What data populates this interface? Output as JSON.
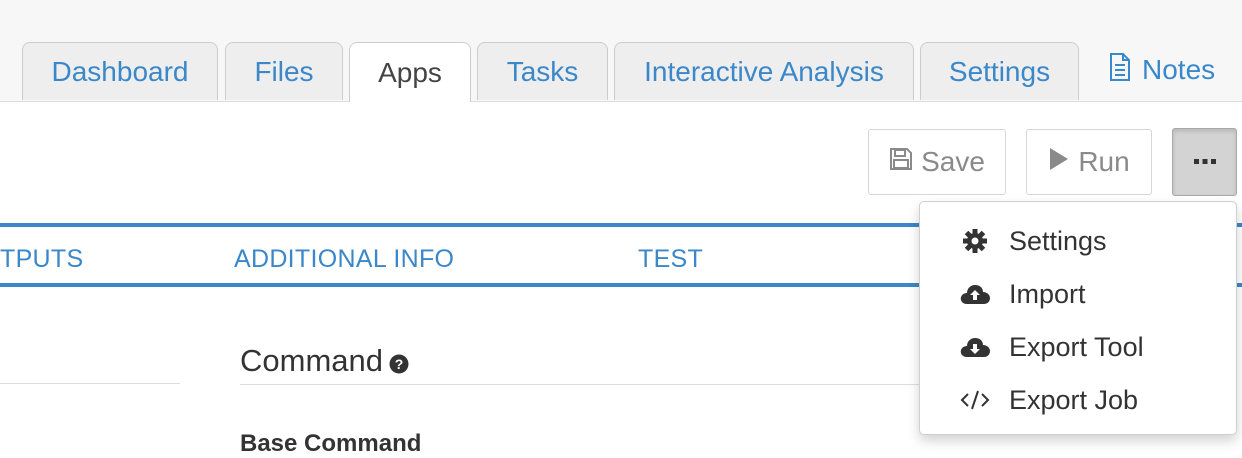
{
  "tabs": [
    {
      "label": "Dashboard",
      "active": false
    },
    {
      "label": "Files",
      "active": false
    },
    {
      "label": "Apps",
      "active": true
    },
    {
      "label": "Tasks",
      "active": false
    },
    {
      "label": "Interactive Analysis",
      "active": false
    },
    {
      "label": "Settings",
      "active": false
    }
  ],
  "notes_link": {
    "label": "Notes",
    "icon": "document-icon"
  },
  "toolbar": {
    "save_label": "Save",
    "save_icon": "floppy-disk-icon",
    "run_label": "Run",
    "run_icon": "play-icon",
    "more_icon": "ellipsis-icon"
  },
  "subnav": {
    "items": [
      "TPUTS",
      "ADDITIONAL INFO",
      "TEST"
    ]
  },
  "content": {
    "section_title": "Command",
    "help_icon": "question-circle-icon",
    "field_label": "Base Command"
  },
  "dropdown": {
    "items": [
      {
        "label": "Settings",
        "icon": "gear-icon"
      },
      {
        "label": "Import",
        "icon": "cloud-upload-icon"
      },
      {
        "label": "Export Tool",
        "icon": "cloud-download-icon"
      },
      {
        "label": "Export Job",
        "icon": "code-icon"
      }
    ]
  },
  "colors": {
    "accent": "#3a87c9",
    "text": "#333333",
    "muted": "#8a8a8a",
    "tab_bg": "#eeeeee"
  }
}
